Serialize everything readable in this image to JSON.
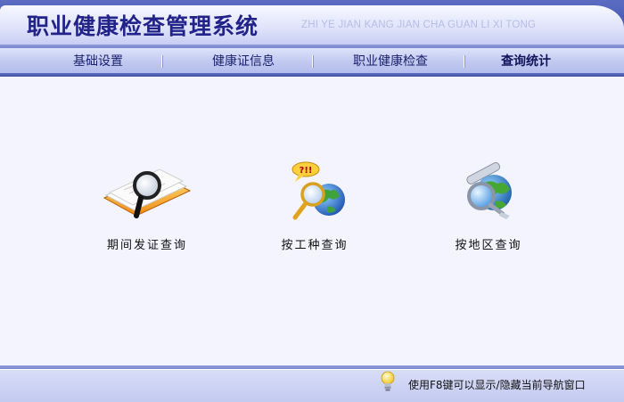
{
  "app": {
    "title": "职业健康检查管理系统",
    "subtitle": "ZHI YE JIAN KANG JIAN CHA GUAN LI XI TONG"
  },
  "menu": {
    "items": [
      {
        "label": "基础设置",
        "active": false
      },
      {
        "label": "健康证信息",
        "active": false
      },
      {
        "label": "职业健康检查",
        "active": false
      },
      {
        "label": "查询统计",
        "active": true
      }
    ]
  },
  "tools": [
    {
      "label": "期间发证查询",
      "icon": "magnifier-document-icon"
    },
    {
      "label": "按工种查询",
      "icon": "magnifier-globe-question-icon"
    },
    {
      "label": "按地区查询",
      "icon": "magnifier-globe-map-icon"
    }
  ],
  "status": {
    "hint": "使用F8键可以显示/隐藏当前导航窗口",
    "icon": "lightbulb-icon"
  }
}
